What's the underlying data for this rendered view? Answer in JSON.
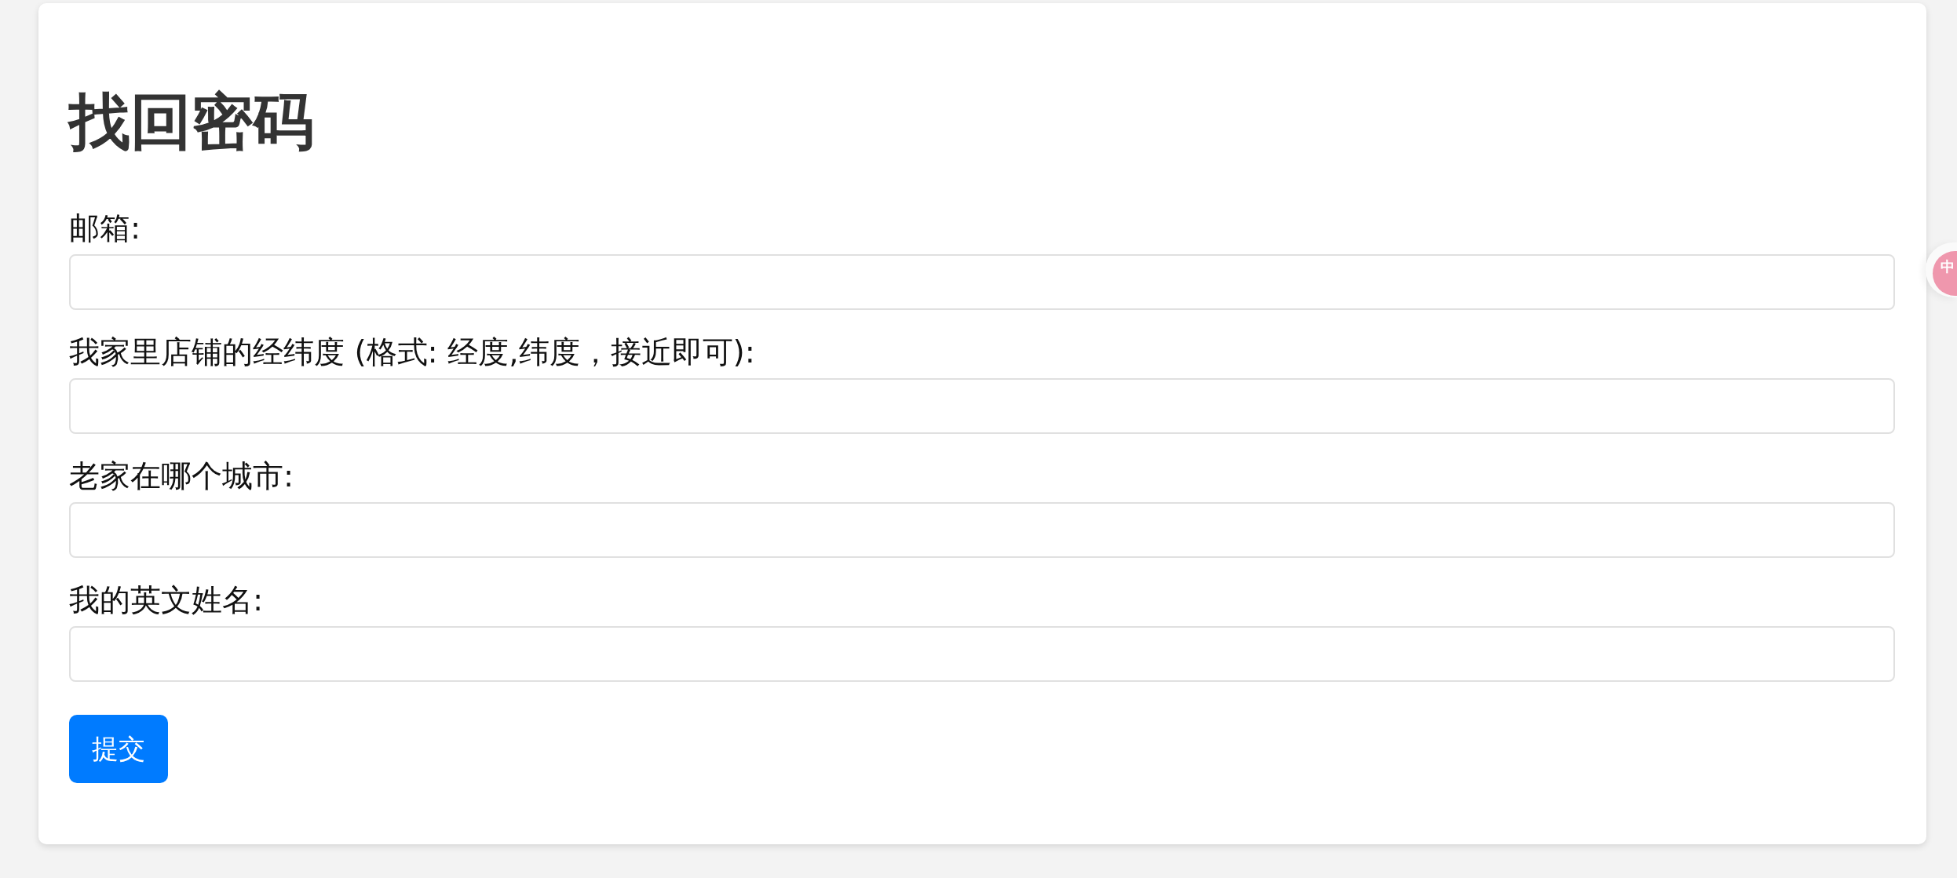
{
  "title": "找回密码",
  "fields": [
    {
      "label": "邮箱:"
    },
    {
      "label": "我家里店铺的经纬度 (格式: 经度,纬度，接近即可):"
    },
    {
      "label": "老家在哪个城市:"
    },
    {
      "label": "我的英文姓名:"
    }
  ],
  "submit_button": {
    "label": "提交"
  },
  "floating_widget": {
    "glyph": "中"
  }
}
